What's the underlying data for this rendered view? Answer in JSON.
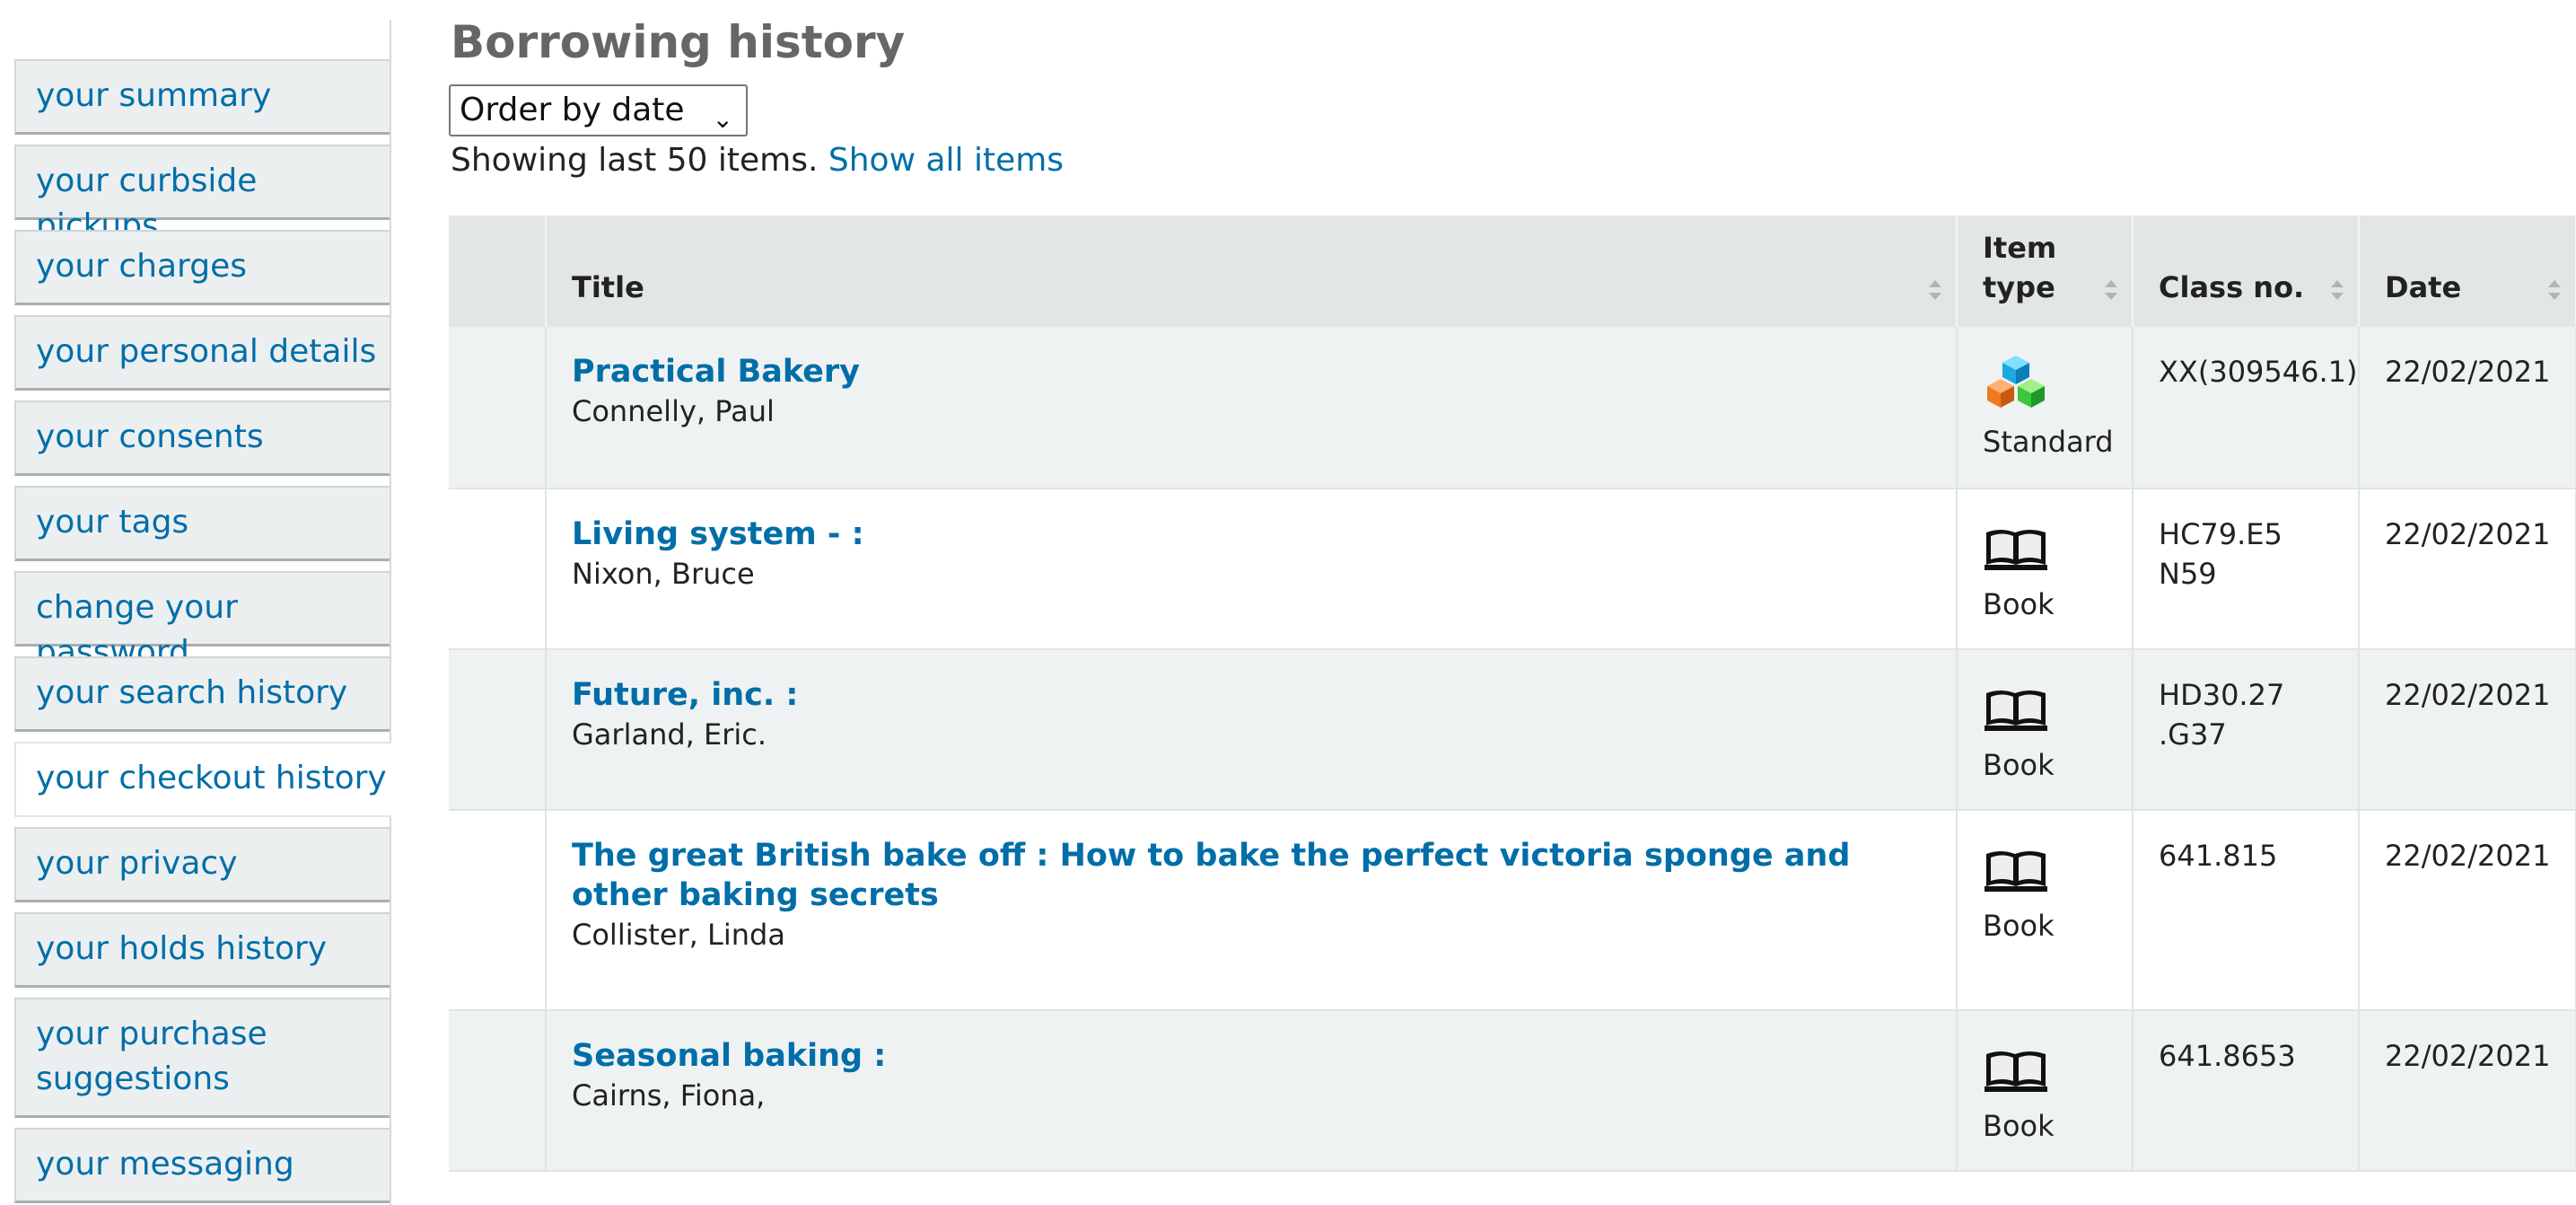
{
  "sidebar": {
    "items": [
      {
        "label": "your summary"
      },
      {
        "label": "your curbside pickups"
      },
      {
        "label": "your charges"
      },
      {
        "label": "your personal details"
      },
      {
        "label": "your consents"
      },
      {
        "label": "your tags"
      },
      {
        "label": "change your password"
      },
      {
        "label": "your search history"
      },
      {
        "label": "your checkout history",
        "current": true
      },
      {
        "label": "your privacy"
      },
      {
        "label": "your holds history"
      },
      {
        "label": "your purchase suggestions"
      },
      {
        "label": "your messaging"
      }
    ]
  },
  "main": {
    "title": "Borrowing history",
    "order_select": {
      "value": "Order by date"
    },
    "showing_text": "Showing last 50 items.",
    "show_all_link": "Show all items",
    "table": {
      "headers": {
        "title": "Title",
        "item_type": "Item type",
        "class_no": "Class no.",
        "date": "Date"
      },
      "rows": [
        {
          "title": "Practical Bakery",
          "author": "Connelly, Paul",
          "item_type": "Standard",
          "icon": "cubes-icon",
          "class_no": "XX(309546.1)",
          "date": "22/02/2021"
        },
        {
          "title": "Living system - :",
          "author": "Nixon, Bruce",
          "item_type": "Book",
          "icon": "book-icon",
          "class_no": "HC79.E5 N59",
          "date": "22/02/2021"
        },
        {
          "title": "Future, inc. :",
          "author": "Garland, Eric.",
          "item_type": "Book",
          "icon": "book-icon",
          "class_no": "HD30.27 .G37",
          "date": "22/02/2021"
        },
        {
          "title": "The great British bake off : How to bake the perfect victoria sponge and other baking secrets",
          "author": "Collister, Linda",
          "item_type": "Book",
          "icon": "book-icon",
          "class_no": "641.815",
          "date": "22/02/2021"
        },
        {
          "title": "Seasonal baking :",
          "author": "Cairns, Fiona,",
          "item_type": "Book",
          "icon": "book-icon",
          "class_no": "641.8653",
          "date": "22/02/2021"
        }
      ]
    }
  },
  "colors": {
    "link": "#006ea8",
    "header_bg": "#e3e6e6",
    "row_alt": "#eff2f2",
    "sidebar_bg": "#eceff0"
  }
}
